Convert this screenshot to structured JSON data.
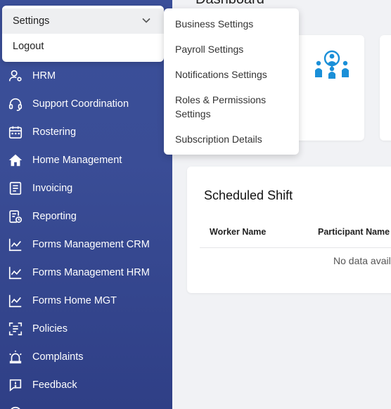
{
  "settings_menu": {
    "head_label": "Settings",
    "logout_label": "Logout"
  },
  "sidebar": {
    "items": [
      {
        "label": "HRM",
        "icon": "user-settings-icon"
      },
      {
        "label": "Support Coordination",
        "icon": "headset-icon"
      },
      {
        "label": "Rostering",
        "icon": "calendar-icon"
      },
      {
        "label": "Home Management",
        "icon": "home-icon"
      },
      {
        "label": "Invoicing",
        "icon": "invoice-icon"
      },
      {
        "label": "Reporting",
        "icon": "report-icon"
      },
      {
        "label": "Forms Management CRM",
        "icon": "chart-line-icon"
      },
      {
        "label": "Forms Management HRM",
        "icon": "chart-line-icon"
      },
      {
        "label": "Forms Home MGT",
        "icon": "chart-line-icon"
      },
      {
        "label": "Policies",
        "icon": "policy-scan-icon"
      },
      {
        "label": "Complaints",
        "icon": "alarm-icon"
      },
      {
        "label": "Feedback",
        "icon": "feedback-icon"
      }
    ]
  },
  "submenu": {
    "items": [
      "Business Settings",
      "Payroll Settings",
      "Notifications Settings",
      "Roles & Permissions Settings",
      "Subscription Details"
    ]
  },
  "main": {
    "page_title": "Dashboard",
    "scheduled_shift": {
      "title": "Scheduled Shift",
      "columns": [
        "Worker Name",
        "Participant Name"
      ],
      "empty_text": "No data avail"
    }
  },
  "colors": {
    "sidebar": "#3a4d96",
    "accent_icon": "#1a8fd8"
  }
}
